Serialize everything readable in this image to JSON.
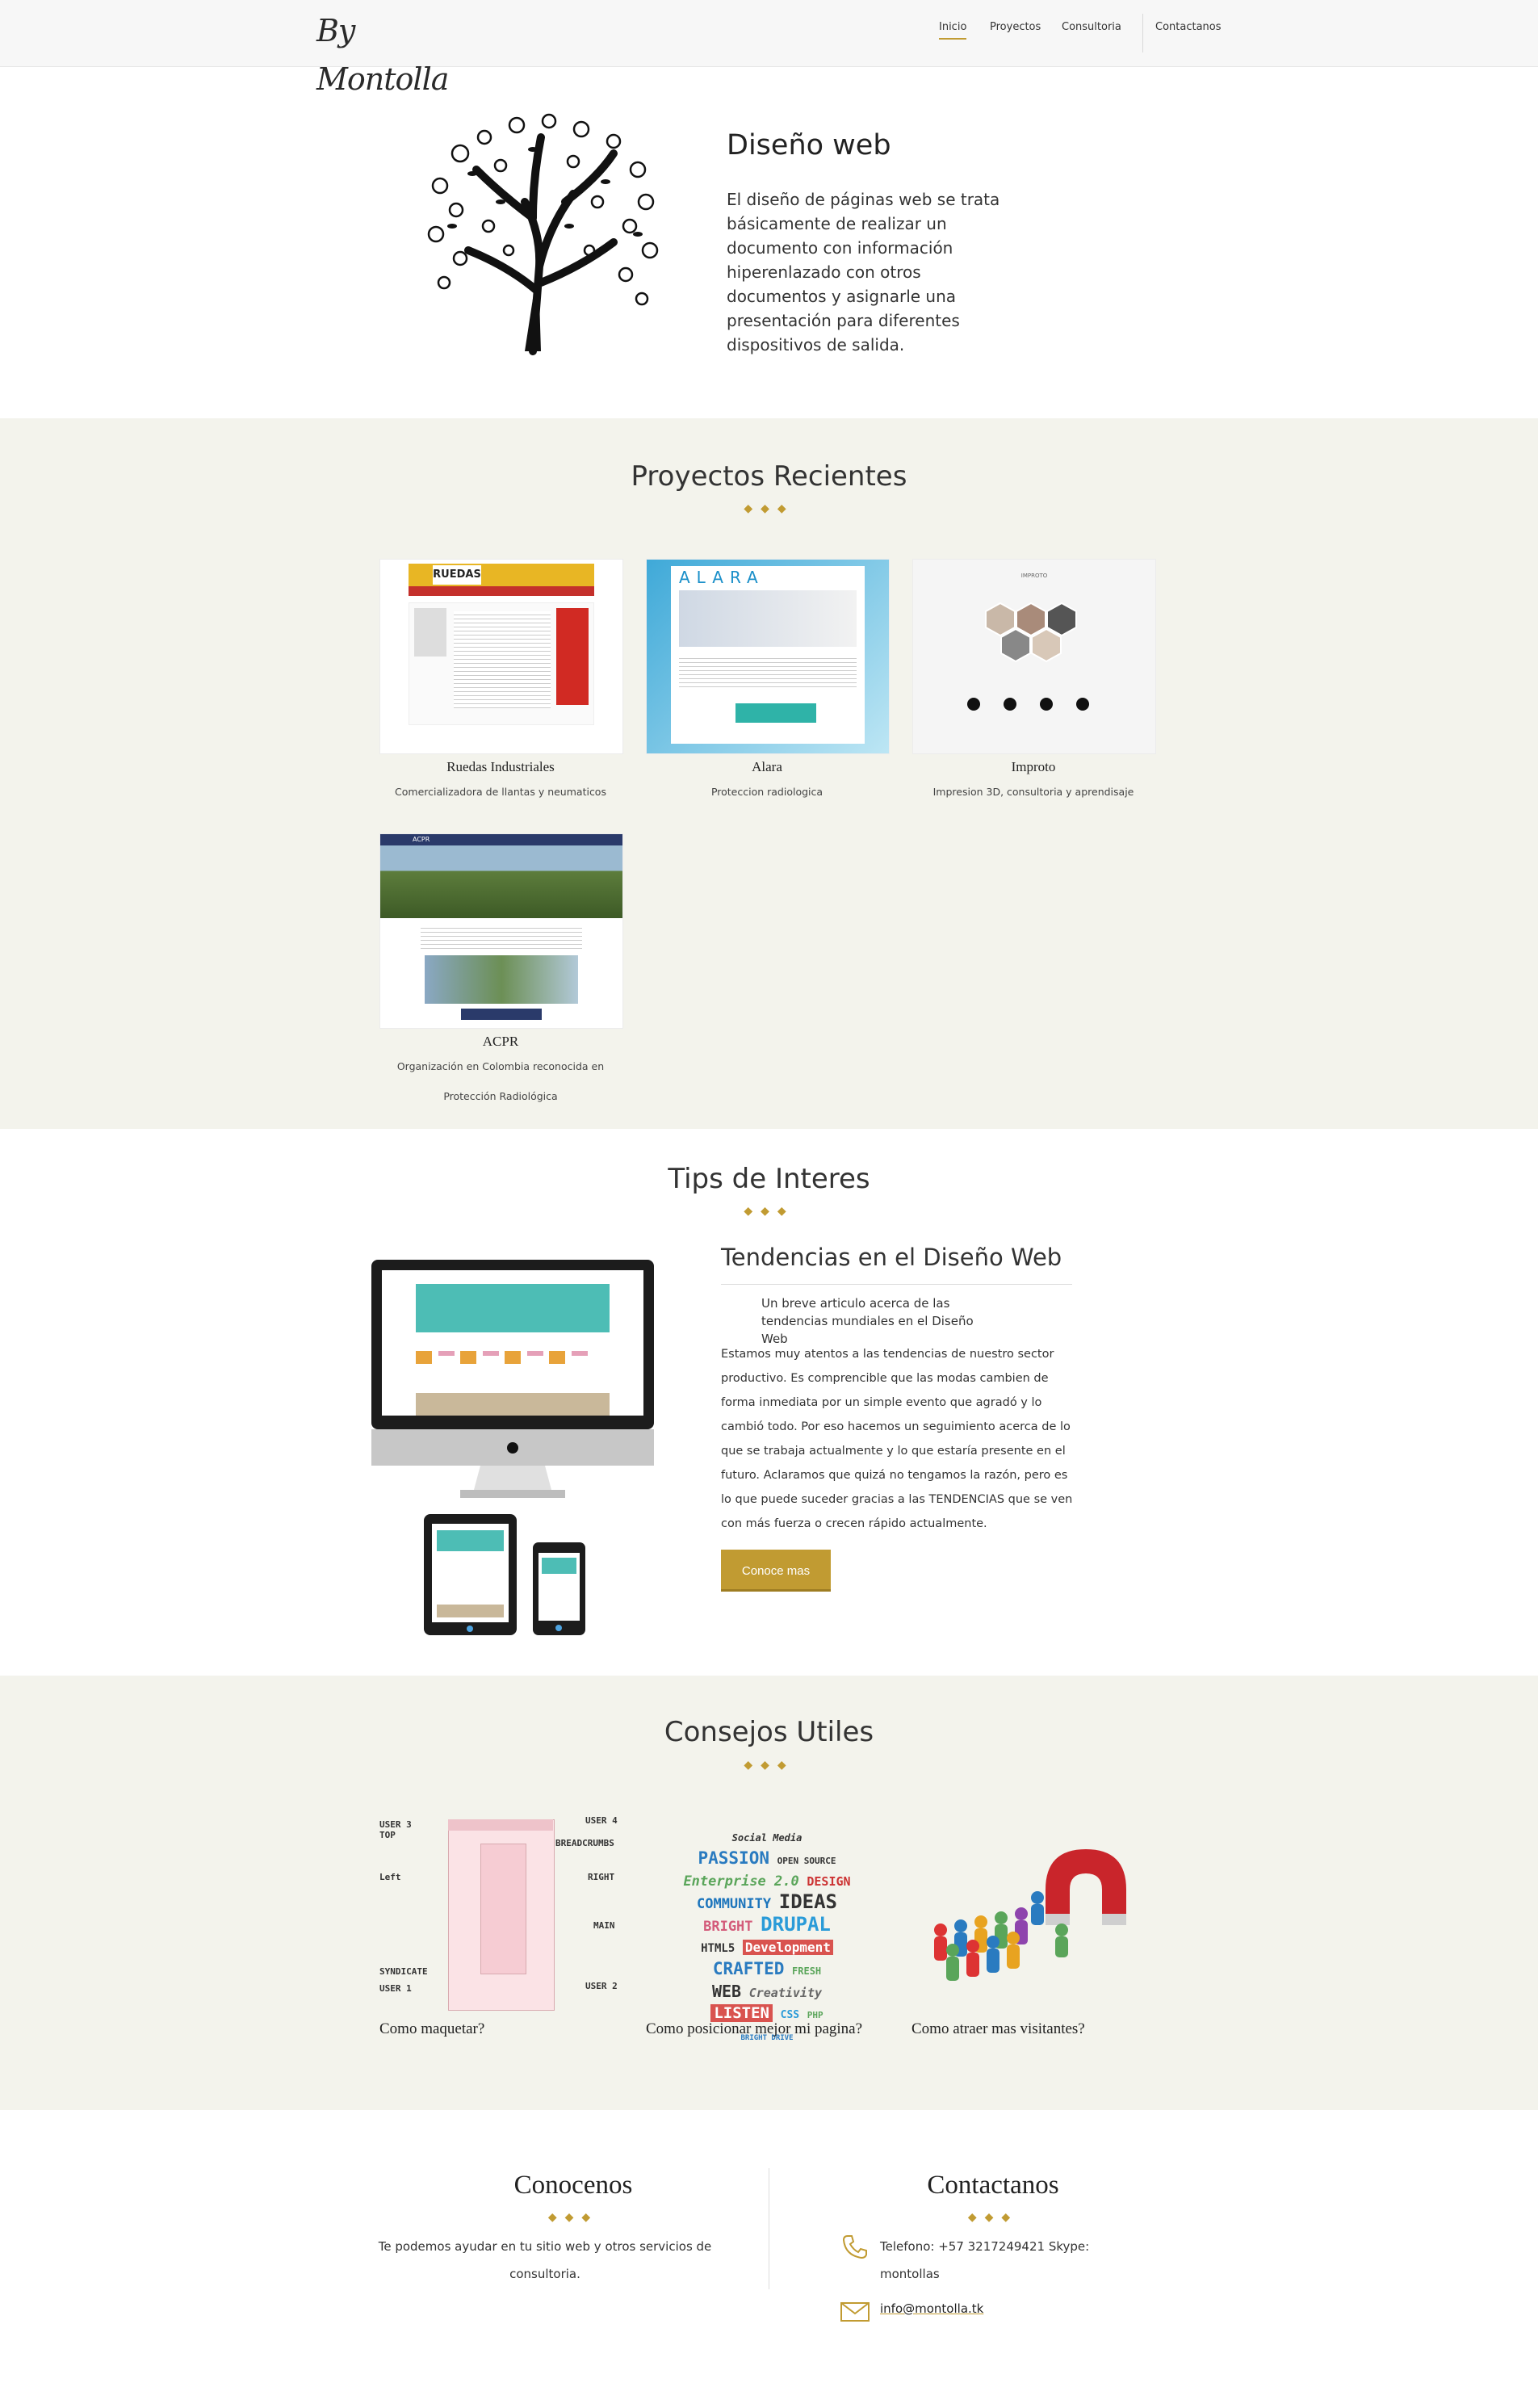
{
  "header": {
    "logo": "By Montolla",
    "nav": [
      "Inicio",
      "Proyectos",
      "Consultoria",
      "Contactanos"
    ]
  },
  "hero": {
    "title": "Diseño web",
    "text": "El diseño de páginas web se trata básicamente de realizar un documento con información hiperenlazado con otros documentos y asignarle una presentación para diferentes dispositivos de salida."
  },
  "proyectos": {
    "title": "Proyectos Recientes",
    "items": [
      {
        "name": "Ruedas Industriales",
        "desc": "Comercializadora de llantas y neumaticos",
        "thumb_text": "RUEDAS"
      },
      {
        "name": "Alara",
        "desc": "Proteccion radiologica",
        "thumb_text": "ALARA"
      },
      {
        "name": "Improto",
        "desc": "Impresion 3D, consultoria y aprendisaje",
        "thumb_text": "IMPROTO"
      },
      {
        "name": "ACPR",
        "desc": "Organización en Colombia reconocida en Protección Radiológica",
        "thumb_text": "ACPR"
      }
    ]
  },
  "tips": {
    "title": "Tips de Interes",
    "article_title": "Tendencias en el Diseño Web",
    "lead": "Un breve articulo acerca de las tendencias mundiales en el Diseño Web",
    "body": "Estamos muy atentos a las tendencias de nuestro sector productivo. Es comprencible que las modas cambien de forma inmediata por un simple evento que agradó y lo cambió todo. Por eso hacemos un seguimiento acerca de lo que se trabaja actualmente y lo que estaría presente en el futuro. Aclaramos que quizá no tengamos la razón, pero es lo que puede suceder gracias a las TENDENCIAS que se ven con más fuerza o crecen rápido actualmente.",
    "button": "Conoce mas"
  },
  "consejos": {
    "title": "Consejos Utiles",
    "items": [
      {
        "caption": "Como maquetar?"
      },
      {
        "caption": "Como posicionar mejor mi pagina?"
      },
      {
        "caption": "Como atraer mas visitantes?"
      }
    ],
    "layout_labels": [
      "USER 3",
      "TOP",
      "Left",
      "SYNDICATE",
      "USER 1",
      "USER 4",
      "BREADCRUMBS",
      "RIGHT",
      "MAIN",
      "USER 2"
    ],
    "cloud_words": [
      "Social Media",
      "PASSION",
      "OPEN SOURCE",
      "Enterprise 2.0",
      "DESIGN",
      "COMMUNITY",
      "IDEAS",
      "BRIGHT",
      "DRUPAL",
      "HTML5",
      "Development",
      "CRAFTED",
      "FRESH",
      "WEB",
      "Creativity",
      "LISTEN",
      "CSS",
      "PHP",
      "BRIGHT DRIVE"
    ]
  },
  "footer": {
    "about_title": "Conocenos",
    "about_text": "Te podemos ayudar en tu sitio web y otros servicios de consultoria.",
    "contact_title": "Contactanos",
    "phone": "Telefono: +57 3217249421 Skype: montollas",
    "email": "info@montolla.tk"
  },
  "colors": {
    "accent": "#c19b32",
    "band": "#f3f3ec",
    "teal": "#4dbdb5"
  }
}
